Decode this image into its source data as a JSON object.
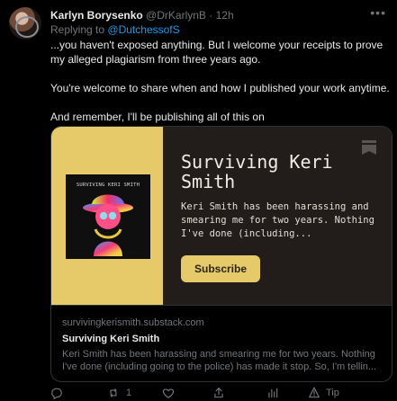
{
  "tweet": {
    "author_name": "Karlyn Borysenko",
    "handle": "@DrKarlynB",
    "time": "12h",
    "reply_prefix": "Replying to",
    "reply_to": "@DutchessofS",
    "paragraphs": [
      "...you haven't exposed anything. But I welcome your receipts to prove my alleged plagiarism from three years ago.",
      "You're welcome to share when and how I published your work anytime.",
      "And remember, I'll be publishing all of this on"
    ],
    "more_glyph": "•••"
  },
  "card": {
    "cover_label": "SURVIVING KERI SMITH",
    "title": "Surviving Keri Smith",
    "description": "Keri Smith has been harassing and smearing me for two years. Nothing I've done (including...",
    "subscribe_label": "Subscribe",
    "domain": "survivingkerismith.substack.com",
    "meta_title": "Surviving Keri Smith",
    "meta_description": "Keri Smith has been harassing and smearing me for two years. Nothing I've done (including going to the police) has made it stop. So, I'm tellin..."
  },
  "actions": {
    "retweet_count": "1",
    "tip_label": "Tip"
  },
  "colors": {
    "accent": "#1d9bf0",
    "muted": "#71767b",
    "card_yellow": "#e6ca6a"
  }
}
